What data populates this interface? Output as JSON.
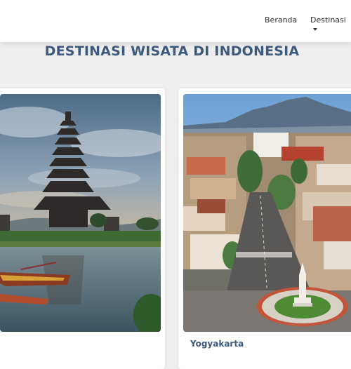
{
  "navbar": {
    "home_label": "Beranda",
    "destinations_label": "Destinasi"
  },
  "page": {
    "title": "DESTINASI WISATA DI INDONESIA"
  },
  "cards": [
    {
      "caption": "",
      "image": "bali-temple-lake-photo"
    },
    {
      "caption": "Yogyakarta",
      "image": "yogyakarta-city-tugu-photo"
    }
  ]
}
